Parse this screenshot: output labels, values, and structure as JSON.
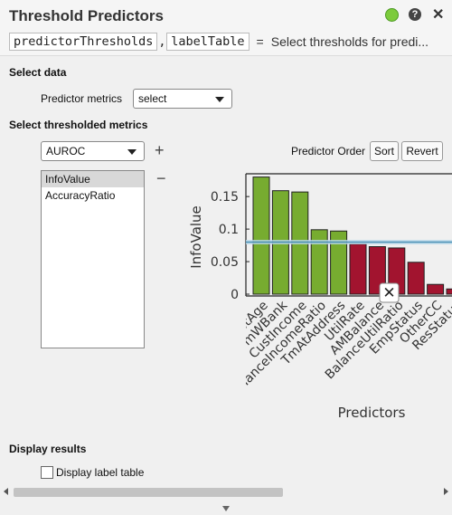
{
  "header": {
    "title": "Threshold Predictors",
    "status_color": "#7ccb3c",
    "help_glyph": "?",
    "close_glyph": "✕"
  },
  "code": {
    "output1": "predictorThresholds",
    "comma": ",",
    "output2": "labelTable",
    "equals": "=",
    "description": "Select thresholds for predi..."
  },
  "select_data": {
    "heading": "Select data",
    "predictor_metrics_label": "Predictor metrics",
    "predictor_metrics_value": "select"
  },
  "thresholded": {
    "heading": "Select thresholded metrics",
    "metric_dropdown_value": "AUROC",
    "add_glyph": "+",
    "remove_glyph": "−",
    "list_items": [
      "InfoValue",
      "AccuracyRatio"
    ],
    "predictor_order_label": "Predictor Order",
    "sort_label": "Sort",
    "revert_label": "Revert"
  },
  "chart_data": {
    "type": "bar",
    "ylabel": "InfoValue",
    "xlabel": "Predictors",
    "ylim": [
      0,
      0.185
    ],
    "yticks": [
      "0",
      "0.05",
      "0.1",
      "0.15"
    ],
    "threshold": 0.08,
    "threshold_icon": "close-icon",
    "categories": [
      "CustAge",
      "TmWBank",
      "CustIncome",
      "BalanceIncomeRatio",
      "TmAtAddress",
      "UtilRate",
      "AMBalance",
      "BalanceUtilRatio",
      "EmpStatus",
      "OtherCC",
      "ResStatus"
    ],
    "values": [
      0.18,
      0.159,
      0.157,
      0.099,
      0.097,
      0.077,
      0.073,
      0.071,
      0.049,
      0.015,
      0.008
    ],
    "colors": {
      "above": "#77ac30",
      "below": "#a2142f",
      "threshold_line": "#4a90b5"
    }
  },
  "display": {
    "heading": "Display results",
    "checkbox_label": "Display label table",
    "checked": false
  }
}
